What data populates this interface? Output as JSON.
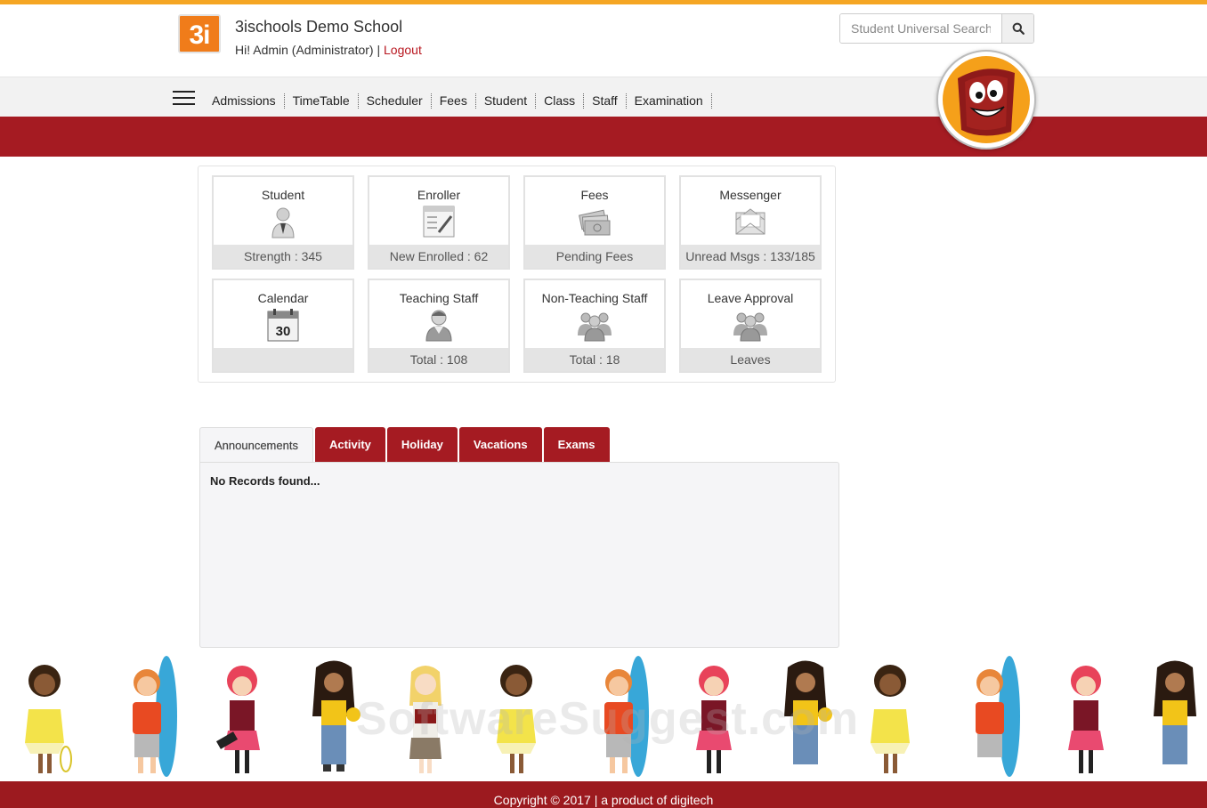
{
  "header": {
    "logo_text": "3i",
    "logo_word": "schools",
    "school_name": "3ischools Demo School",
    "greeting": "Hi! Admin (Administrator) |",
    "logout_label": "Logout",
    "search_placeholder": "Student Universal Search",
    "search_icon": "search-icon",
    "brand_color": "#a51b22",
    "accent_color": "#f5a623"
  },
  "nav": {
    "menu_icon": "hamburger-menu-icon",
    "items": [
      "Admissions",
      "TimeTable",
      "Scheduler",
      "Fees",
      "Student",
      "Class",
      "Staff",
      "Examination"
    ]
  },
  "tiles": [
    {
      "title": "Student",
      "footer": "Strength : 345",
      "icon": "student-icon"
    },
    {
      "title": "Enroller",
      "footer": "New Enrolled : 62",
      "icon": "enroller-form-icon"
    },
    {
      "title": "Fees",
      "footer": "Pending Fees",
      "icon": "money-icon"
    },
    {
      "title": "Messenger",
      "footer": "Unread Msgs : 133/185",
      "icon": "envelope-icon"
    },
    {
      "title": "Calendar",
      "footer": "",
      "icon": "calendar-icon",
      "calendar_day": "30"
    },
    {
      "title": "Teaching Staff",
      "footer": "Total : 108",
      "icon": "teacher-icon"
    },
    {
      "title": "Non-Teaching Staff",
      "footer": "Total : 18",
      "icon": "staff-group-icon"
    },
    {
      "title": "Leave Approval",
      "footer": "Leaves",
      "icon": "leave-group-icon"
    }
  ],
  "tabs": {
    "items": [
      "Announcements",
      "Activity",
      "Holiday",
      "Vacations",
      "Exams"
    ],
    "active": "Announcements",
    "empty_message": "No Records found..."
  },
  "watermark": "SoftwareSuggest.com",
  "footer": {
    "copyright": "Copyright © 2017 | a product of digitech"
  }
}
